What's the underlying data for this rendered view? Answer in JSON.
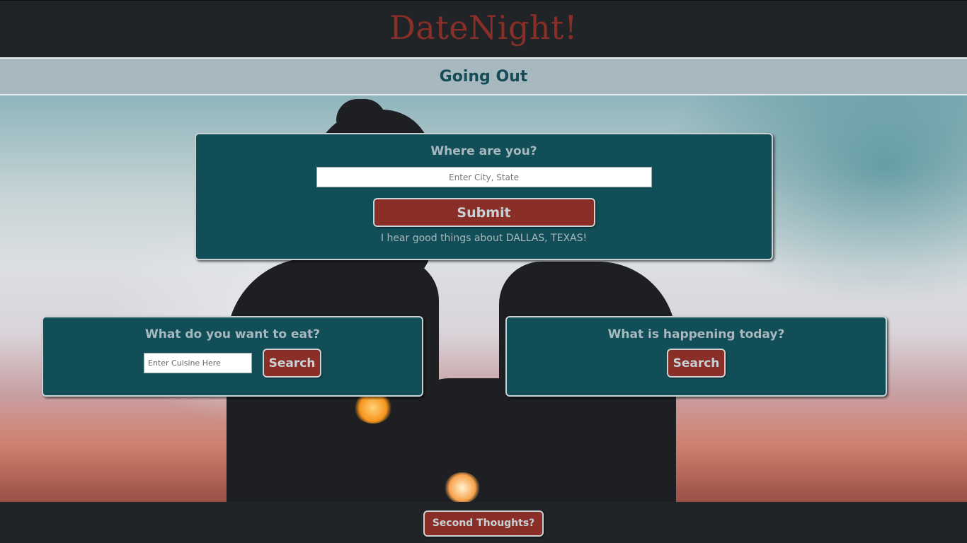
{
  "header": {
    "brand": "DateNight!",
    "section_title": "Going Out"
  },
  "location": {
    "title": "Where are you?",
    "input_placeholder": "Enter City, State",
    "input_value": "",
    "submit_label": "Submit",
    "message": "I hear good things about DALLAS, TEXAS!"
  },
  "food": {
    "title": "What do you want to eat?",
    "input_placeholder": "Enter Cuisine Here",
    "input_value": "",
    "search_label": "Search"
  },
  "events": {
    "title": "What is happening today?",
    "search_label": "Search"
  },
  "footer": {
    "second_thoughts_label": "Second Thoughts?"
  },
  "colors": {
    "brand_red": "#8a2e28",
    "teal_card": "#124e57",
    "header_dark": "#212427",
    "subnav_bg": "#a7b9bf"
  }
}
